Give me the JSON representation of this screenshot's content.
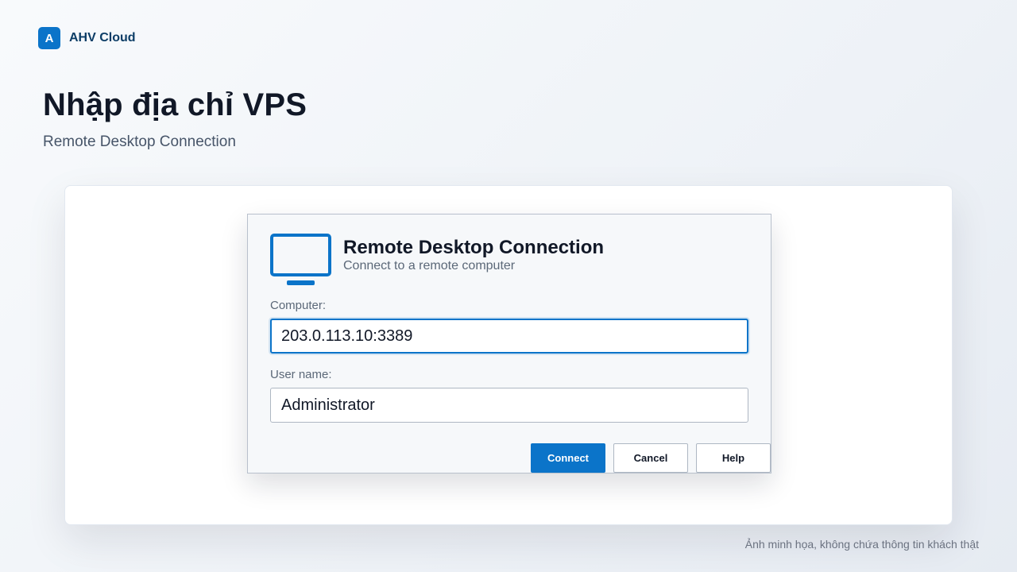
{
  "brand": {
    "logo_letter": "A",
    "name": "AHV Cloud"
  },
  "page": {
    "title": "Nhập địa chỉ VPS",
    "subtitle": "Remote Desktop Connection"
  },
  "dialog": {
    "icon": "monitor-icon",
    "title": "Remote Desktop Connection",
    "subtitle": "Connect to a remote computer",
    "computer": {
      "label": "Computer:",
      "value": "203.0.113.10:3389"
    },
    "username": {
      "label": "User name:",
      "value": "Administrator"
    },
    "buttons": {
      "connect": "Connect",
      "cancel": "Cancel",
      "help": "Help"
    }
  },
  "footer_note": "Ảnh minh họa, không chứa thông tin khách thật",
  "colors": {
    "accent": "#0b74c9",
    "brand_text": "#0c3d66"
  }
}
